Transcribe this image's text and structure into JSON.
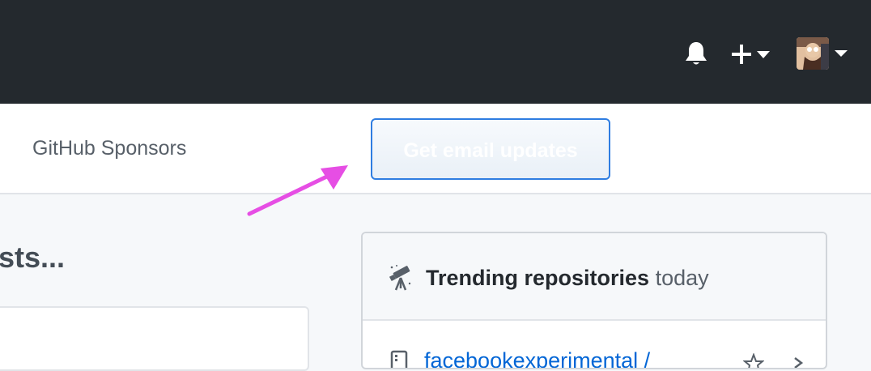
{
  "header": {
    "icons": {
      "notifications": "bell-icon",
      "create": "plus-icon",
      "create_caret": "caret-down-icon",
      "avatar_caret": "caret-down-icon"
    }
  },
  "subnav": {
    "sponsors_label": "GitHub Sponsors",
    "email_button_label": "Get email updates"
  },
  "main": {
    "heading": "sts..."
  },
  "trending": {
    "title": "Trending repositories",
    "period": "today",
    "icon": "telescope-icon",
    "first_repo_link": "facebookexperimental /"
  },
  "colors": {
    "header_bg": "#24292e",
    "link_blue": "#0366d6",
    "button_border": "#2f7de1",
    "arrow_magenta": "#e64ee4",
    "page_bg": "#f6f8fa"
  }
}
